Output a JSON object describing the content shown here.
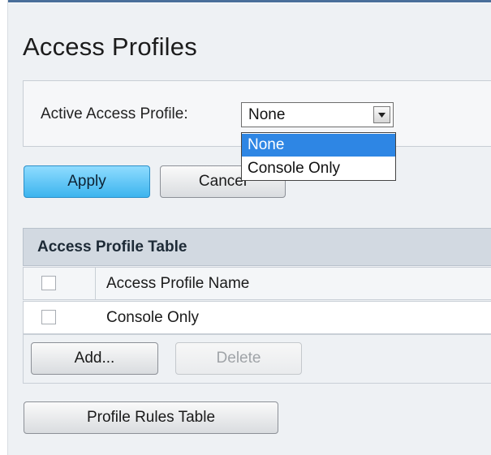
{
  "page": {
    "title": "Access Profiles"
  },
  "filter": {
    "label": "Active Access Profile:",
    "selected": "None",
    "options": [
      "None",
      "Console Only"
    ]
  },
  "buttons": {
    "apply": "Apply",
    "cancel": "Cancel",
    "add": "Add...",
    "delete": "Delete",
    "profile_rules": "Profile Rules Table"
  },
  "table": {
    "title": "Access Profile Table",
    "column_header": "Access Profile Name",
    "rows": [
      {
        "name": "Console Only"
      }
    ]
  },
  "colors": {
    "accent": "#3cb4ee",
    "dropdown_highlight": "#2e86e4",
    "panel_bg": "#eef1f4",
    "table_header_bg": "#d2d9e1"
  },
  "icons": {
    "dropdown_arrow": "chevron-down-icon"
  }
}
